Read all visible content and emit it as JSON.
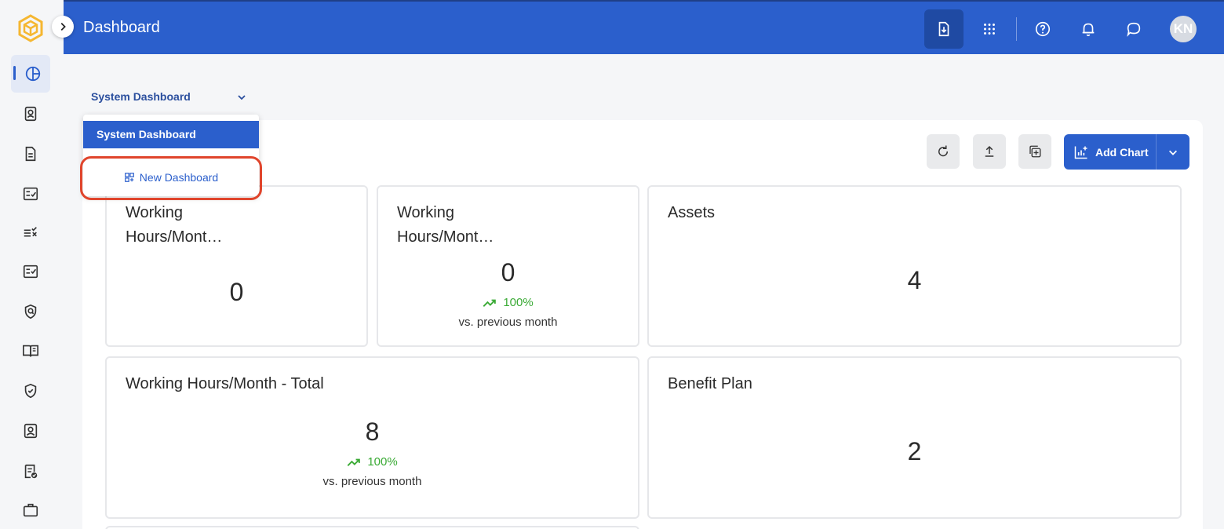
{
  "header": {
    "title": "Dashboard",
    "avatar_initials": "KN",
    "buttons": [
      "export-icon",
      "apps-grid-icon",
      "help-icon",
      "bell-icon",
      "chat-icon"
    ]
  },
  "sidebar": {
    "items": [
      "chart-pie-icon",
      "contact-card-icon",
      "document-icon",
      "checklist-icon",
      "task-list-icon",
      "checklist-alt-icon",
      "shield-search-icon",
      "book-icon",
      "shield-check-icon",
      "person-card-icon",
      "form-check-icon",
      "briefcase-icon"
    ]
  },
  "dashboard_selector": {
    "current": "System Dashboard",
    "options": [
      {
        "label": "System Dashboard",
        "selected": true
      },
      {
        "label": "New Dashboard",
        "selected": false
      }
    ]
  },
  "toolbar": {
    "add_chart_label": "Add Chart"
  },
  "cards": [
    {
      "title": "Working Hours/Mont…",
      "value": "0"
    },
    {
      "title": "Working Hours/Mont…",
      "value": "0",
      "trend": "100%",
      "sub": "vs. previous month"
    },
    {
      "title": "Assets",
      "value": "4"
    },
    {
      "title": "Working Hours/Month - Total",
      "value": "8",
      "trend": "100%",
      "sub": "vs. previous month"
    },
    {
      "title": "Benefit Plan",
      "value": "2"
    }
  ],
  "colors": {
    "primary": "#2b5fcc",
    "trend_up": "#3aaa35",
    "highlight": "#e0452c"
  }
}
